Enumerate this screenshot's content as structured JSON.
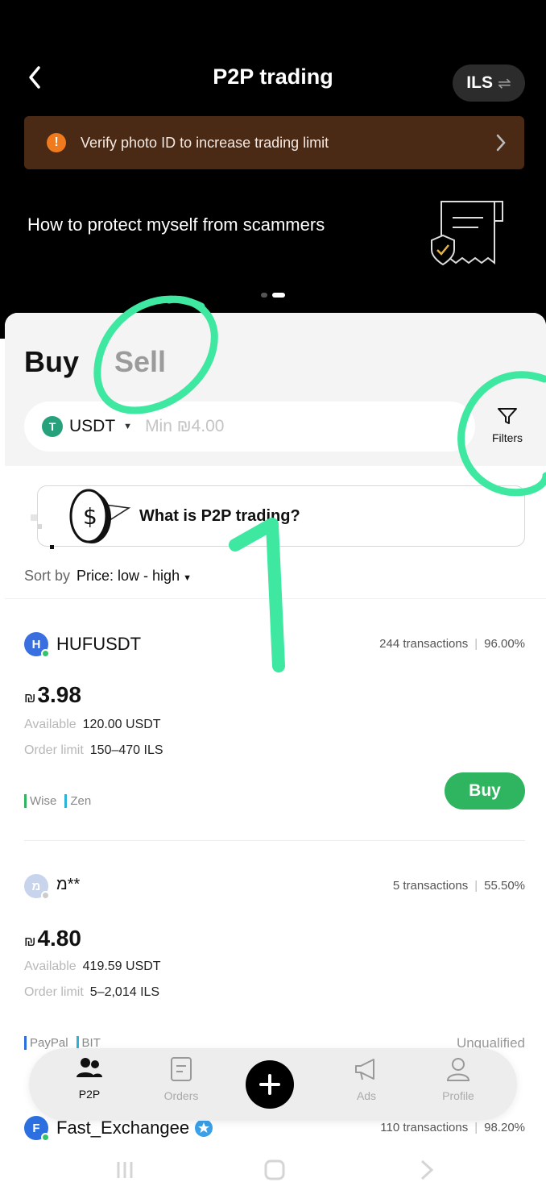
{
  "header": {
    "title": "P2P trading",
    "currency": "ILS",
    "swap_glyph": "⇌"
  },
  "verify_banner": {
    "text": "Verify photo ID to increase trading limit",
    "icon": "!"
  },
  "promo": {
    "text": "How to protect myself from scammers"
  },
  "tabs": {
    "buy": "Buy",
    "sell": "Sell"
  },
  "filter_bar": {
    "coin": "USDT",
    "coin_icon_letter": "T",
    "min_placeholder": "Min ₪4.00",
    "filters_label": "Filters"
  },
  "info_card": {
    "text": "What is P2P trading?"
  },
  "sort": {
    "label": "Sort by",
    "value": "Price: low - high"
  },
  "merchants": [
    {
      "avatar_letter": "H",
      "name": "HUFUSDT",
      "transactions": "244 transactions",
      "completion": "96.00%",
      "currency_symbol": "₪",
      "price": "3.98",
      "available_label": "Available",
      "available": "120.00 USDT",
      "limit_label": "Order limit",
      "limit": "150–470 ILS",
      "payments": [
        "Wise",
        "Zen"
      ],
      "action": "Buy"
    },
    {
      "avatar_letter": "מ",
      "name": "מ**",
      "transactions": "5 transactions",
      "completion": "55.50%",
      "currency_symbol": "₪",
      "price": "4.80",
      "available_label": "Available",
      "available": "419.59 USDT",
      "limit_label": "Order limit",
      "limit": "5–2,014 ILS",
      "payments": [
        "PayPal",
        "BIT"
      ],
      "status": "Unqualified"
    },
    {
      "avatar_letter": "F",
      "name": "Fast_Exchangee",
      "transactions": "110 transactions",
      "completion": "98.20%"
    }
  ],
  "bottom_nav": {
    "p2p": "P2P",
    "orders": "Orders",
    "ads": "Ads",
    "profile": "Profile"
  },
  "colors": {
    "accent_green": "#2fb55f",
    "banner_bg": "#4a2a15",
    "warn_orange": "#f07a1e",
    "tether_green": "#26a17b",
    "annotation_green": "#3ee8a0"
  }
}
